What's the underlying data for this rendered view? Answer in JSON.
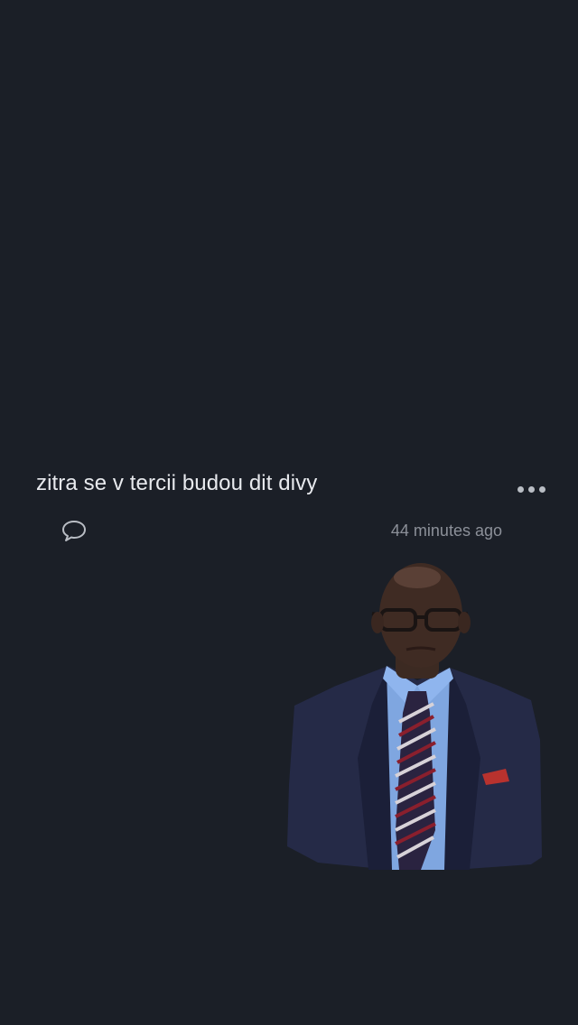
{
  "post": {
    "text": "zitra se v tercii budou dit divy",
    "timestamp": "44 minutes ago",
    "comment_icon": "speech-bubble-icon",
    "more_icon": "ellipsis-icon"
  },
  "sticker": {
    "description_icon": "man-in-suit-sticker"
  },
  "colors": {
    "background": "#1b1f27",
    "text": "#e8eaee",
    "muted": "#8c9099"
  }
}
